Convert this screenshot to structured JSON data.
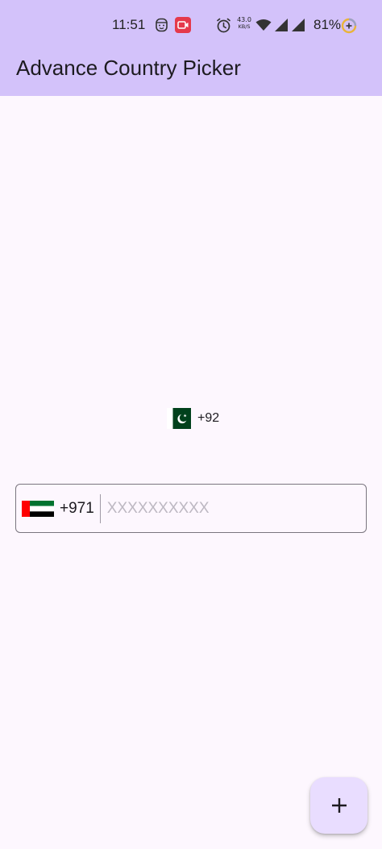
{
  "status_bar": {
    "time": "11:51",
    "net_speed_value": "43.0",
    "net_speed_unit": "KB/S",
    "battery": "81%",
    "icons": [
      "face-icon",
      "screen-record-icon",
      "alarm-icon",
      "wifi-icon",
      "signal-icon",
      "signal-icon",
      "battery-saver-icon"
    ]
  },
  "app_bar": {
    "title": "Advance Country Picker",
    "background": "#d3c2fa"
  },
  "country_picker": {
    "flag": "pakistan-flag-icon",
    "dial_code": "+92"
  },
  "phone_field": {
    "flag": "uae-flag-icon",
    "dial_code": "+971",
    "value": "",
    "placeholder": "XXXXXXXXXX"
  },
  "fab": {
    "icon": "plus-icon",
    "background": "#e9ddff"
  },
  "colors": {
    "page_background": "#fdf7fe",
    "accent": "#d3c2fa"
  }
}
